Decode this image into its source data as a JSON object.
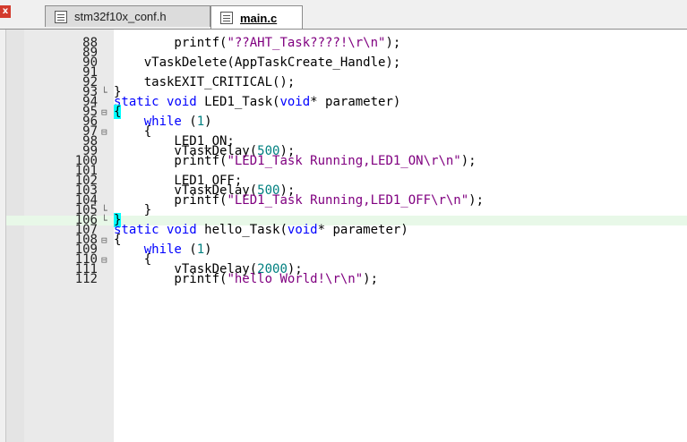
{
  "tabs": [
    {
      "label": "stm32f10x_conf.h",
      "active": false
    },
    {
      "label": "main.c",
      "active": true
    }
  ],
  "colors": {
    "keyword": "#0000ff",
    "string": "#800080",
    "number": "#008080",
    "highlight": "#e8f8e8",
    "brace_match": "#00ffff"
  },
  "lines": [
    {
      "no": "88",
      "fold": "",
      "text": "        printf(\"??AHT_Task????!\\r\\n\");"
    },
    {
      "no": "89",
      "fold": "",
      "text": ""
    },
    {
      "no": "90",
      "fold": "",
      "text": "    vTaskDelete(AppTaskCreate_Handle);"
    },
    {
      "no": "91",
      "fold": "",
      "text": ""
    },
    {
      "no": "92",
      "fold": "",
      "text": "    taskEXIT_CRITICAL();"
    },
    {
      "no": "93",
      "fold": "└",
      "text": "}"
    },
    {
      "no": "94",
      "fold": "",
      "text": "static void LED1_Task(void* parameter)"
    },
    {
      "no": "95",
      "fold": "⊟",
      "text": "{"
    },
    {
      "no": "96",
      "fold": "",
      "text": "    while (1)"
    },
    {
      "no": "97",
      "fold": "⊟",
      "text": "    {"
    },
    {
      "no": "98",
      "fold": "",
      "text": "        LED1_ON;"
    },
    {
      "no": "99",
      "fold": "",
      "text": "        vTaskDelay(500);"
    },
    {
      "no": "100",
      "fold": "",
      "text": "        printf(\"LED1_Task Running,LED1_ON\\r\\n\");"
    },
    {
      "no": "101",
      "fold": "",
      "text": ""
    },
    {
      "no": "102",
      "fold": "",
      "text": "        LED1_OFF;"
    },
    {
      "no": "103",
      "fold": "",
      "text": "        vTaskDelay(500);"
    },
    {
      "no": "104",
      "fold": "",
      "text": "        printf(\"LED1_Task Running,LED1_OFF\\r\\n\");"
    },
    {
      "no": "105",
      "fold": "└",
      "text": "    }"
    },
    {
      "no": "106",
      "fold": "└",
      "text": "}",
      "highlight": true
    },
    {
      "no": "107",
      "fold": "",
      "text": "static void hello_Task(void* parameter)"
    },
    {
      "no": "108",
      "fold": "⊟",
      "text": "{"
    },
    {
      "no": "109",
      "fold": "",
      "text": "    while (1)"
    },
    {
      "no": "110",
      "fold": "⊟",
      "text": "    {"
    },
    {
      "no": "111",
      "fold": "",
      "text": "        vTaskDelay(2000);"
    },
    {
      "no": "112",
      "fold": "",
      "text": "        printf(\"hello World!\\r\\n\");"
    }
  ]
}
